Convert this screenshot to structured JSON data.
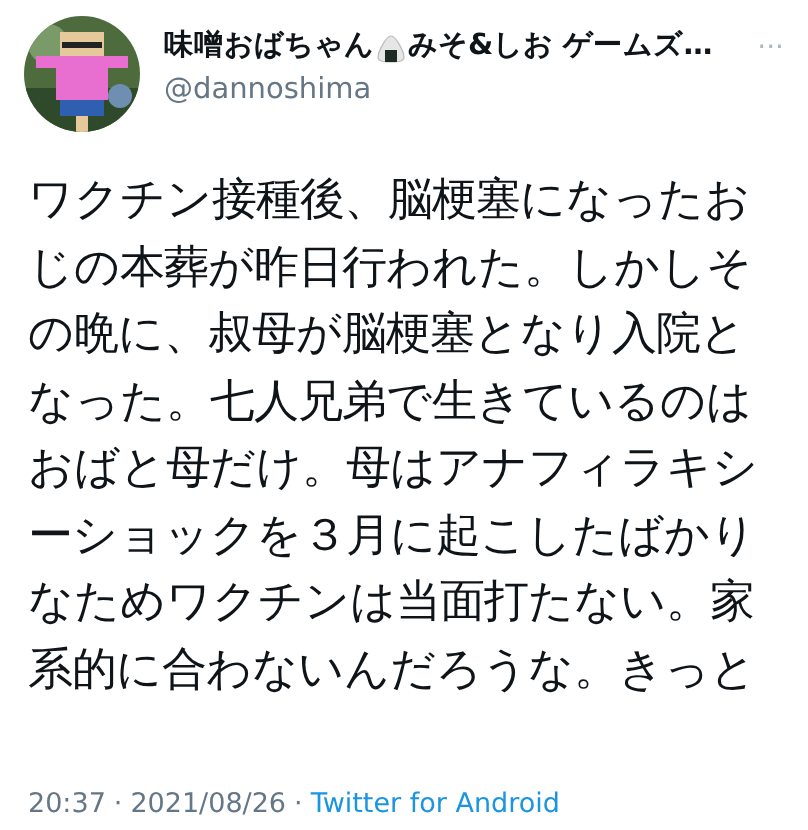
{
  "author": {
    "name_before": "味噌おばちゃん",
    "name_after": "みそ&しお ゲームズ…",
    "handle": "@dannoshima"
  },
  "more": "···",
  "body_lines": [
    "ワクチン接種後、脳梗塞になったお",
    "じの本葬が昨日行われた。しかしそ",
    "の晩に、叔母が脳梗塞となり入院と",
    "なった。七人兄弟で生きているのは",
    "おばと母だけ。母はアナフィラキシ",
    "ーショックを３月に起こしたばかり",
    "なためワクチンは当面打たない。家",
    "系的に合わないんだろうな。きっと"
  ],
  "meta": {
    "time": "20:37",
    "sep1": "·",
    "date": "2021/08/26",
    "sep2": "·",
    "source": "Twitter for Android"
  }
}
